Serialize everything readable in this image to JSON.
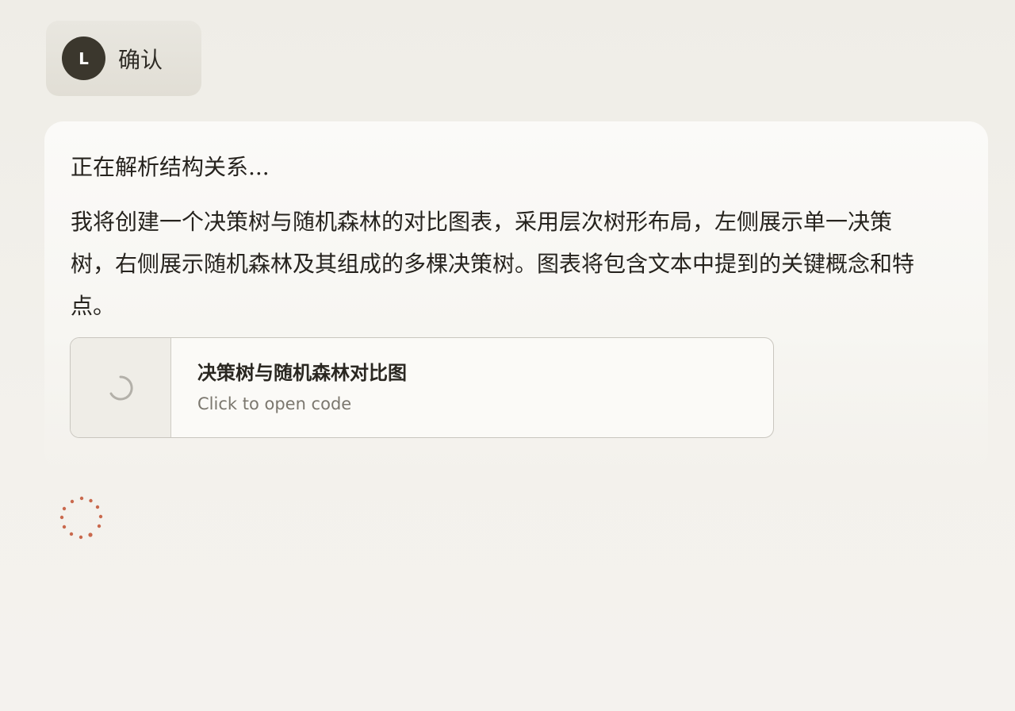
{
  "user_message": {
    "avatar_initial": "L",
    "text": "确认"
  },
  "assistant": {
    "thinking_status": "正在解析结构关系...",
    "paragraph": "我将创建一个决策树与随机森林的对比图表，采用层次树形布局，左侧展示单一决策树，右侧展示随机森林及其组成的多棵决策树。图表将包含文本中提到的关键概念和特点。",
    "artifact": {
      "title": "决策树与随机森林对比图",
      "subtitle": "Click to open code",
      "status_icon": "loading-spinner-icon"
    },
    "activity_icon": "thinking-spinner-icon"
  },
  "colors": {
    "avatar_bg": "#3b372d",
    "accent_spinner": "#c9694d",
    "loader_gray": "#b3b0a9"
  }
}
